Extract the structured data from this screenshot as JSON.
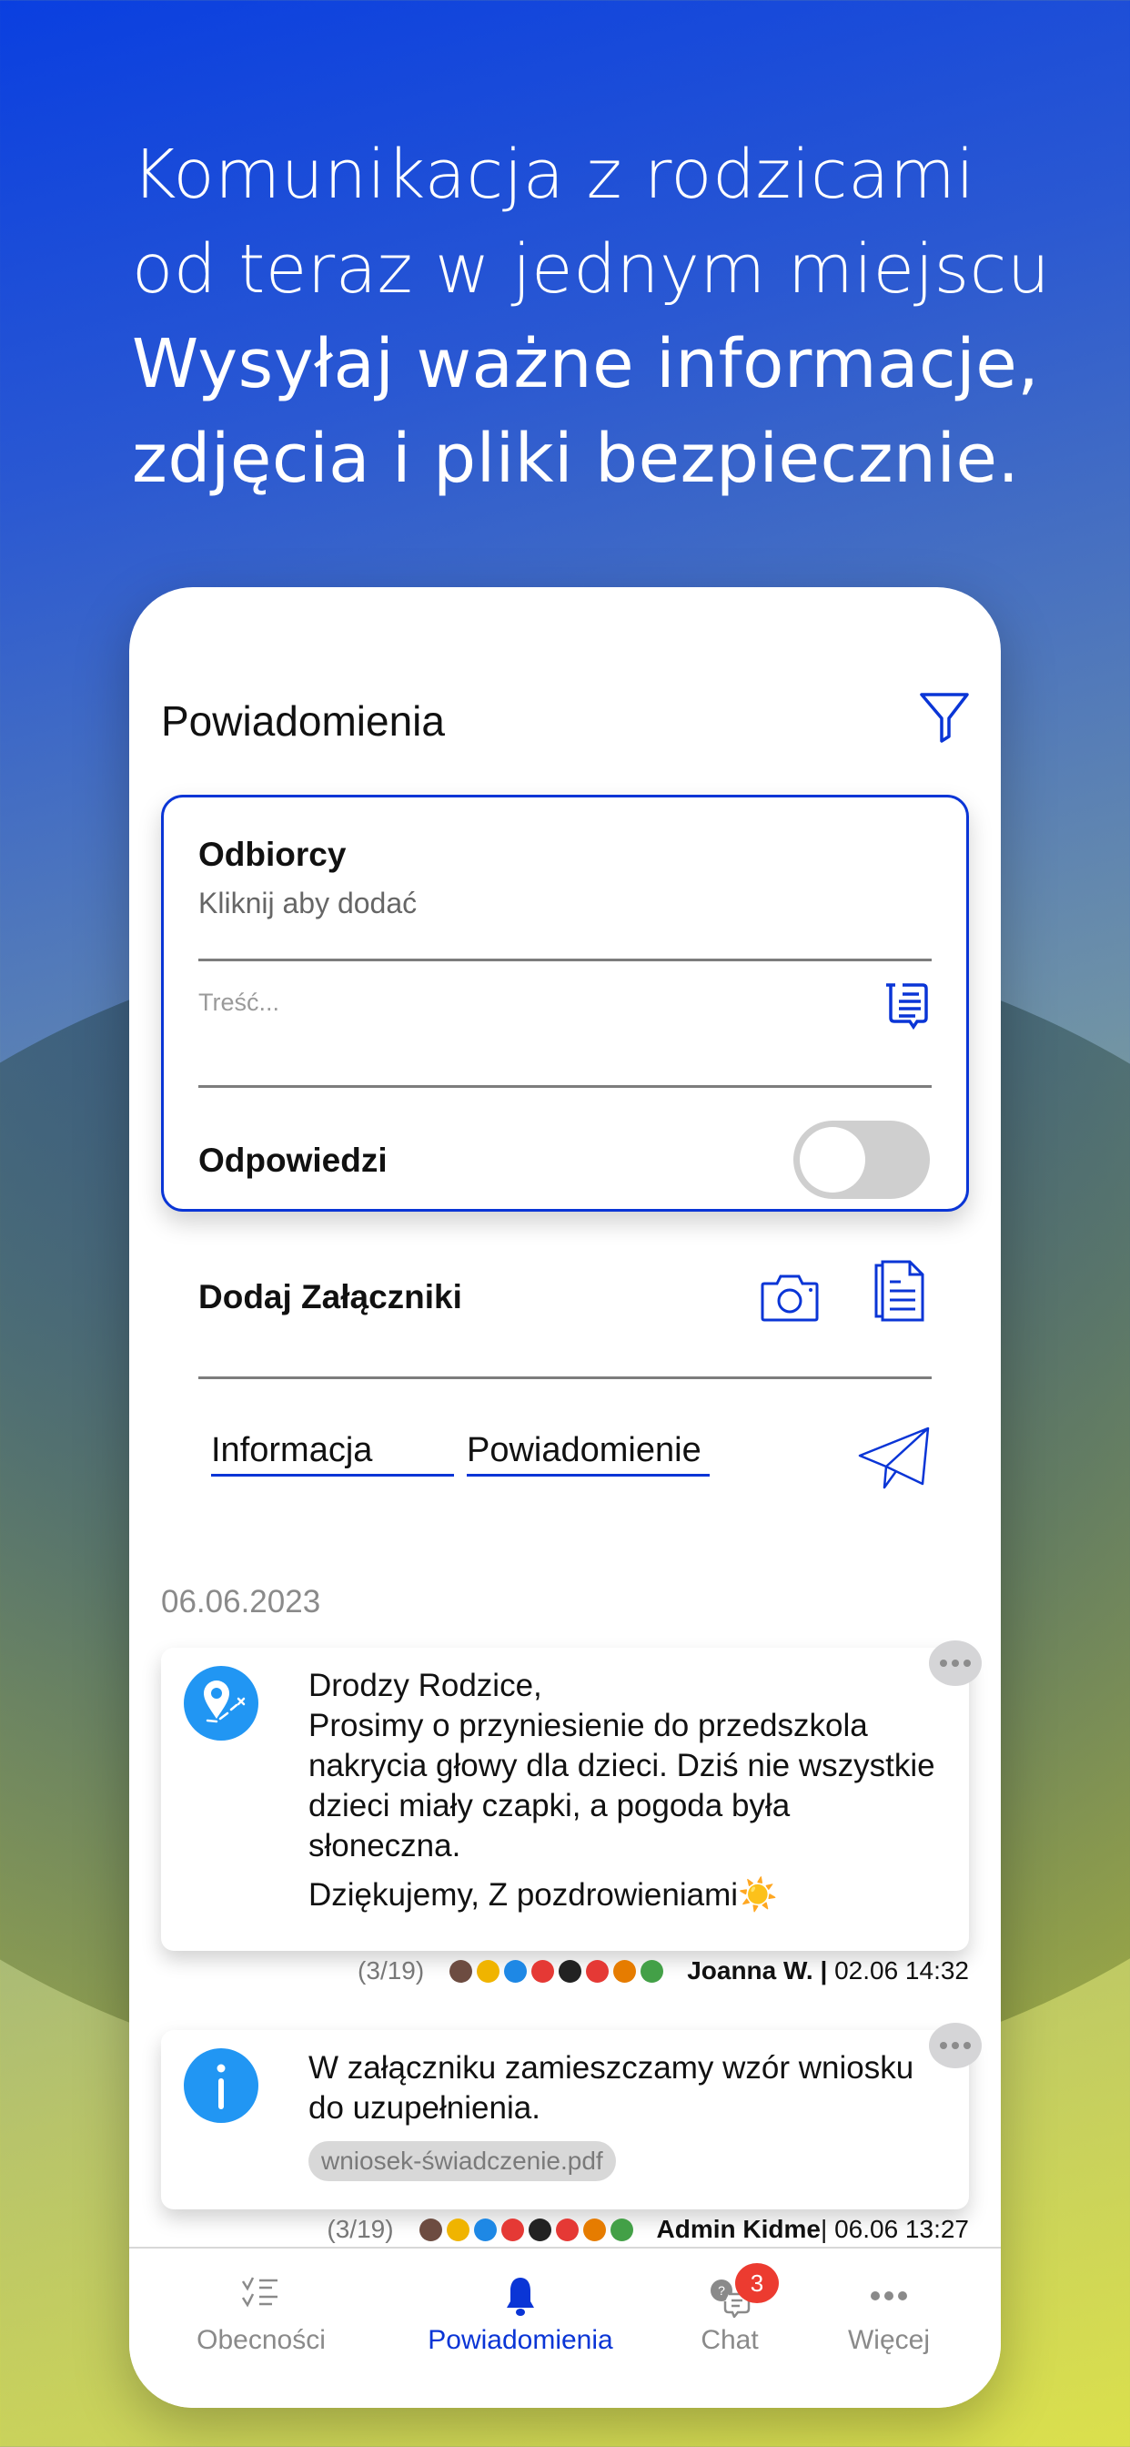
{
  "headline": {
    "line1": "Komunikacja z rodzicami",
    "line2": "od teraz w jednym miejscu",
    "line3": "Wysyłaj ważne informacje,",
    "line4": "zdjęcia i pliki bezpiecznie."
  },
  "header": {
    "title": "Powiadomienia",
    "filter_icon": "filter-icon"
  },
  "composer": {
    "recipients_label": "Odbiorcy",
    "recipients_hint": "Kliknij aby dodać",
    "content_placeholder": "Treść...",
    "replies_label": "Odpowiedzi",
    "replies_enabled": false,
    "attachments_label": "Dodaj Załączniki",
    "types": [
      {
        "label": "Informacja"
      },
      {
        "label": "Powiadomienie"
      }
    ],
    "icons": [
      "template-icon",
      "camera-icon",
      "document-icon",
      "send-icon"
    ]
  },
  "feed": {
    "date": "06.06.2023",
    "posts": [
      {
        "icon": "location-route-icon",
        "lines": [
          "Drodzy Rodzice,",
          "Prosimy o przyniesienie do przedszkola nakrycia głowy dla dzieci. Dziś nie wszystkie dzieci miały czapki, a pogoda była słoneczna.",
          "Dziękujemy, Z pozdrowieniami"
        ],
        "emoji": "☀️",
        "read_count": "(3/19)",
        "author": "Joanna W.",
        "separator": " | ",
        "time": "02.06 14:32"
      },
      {
        "icon": "info-icon",
        "lines": [
          "W załączniku zamieszczamy wzór wniosku do uzupełnienia."
        ],
        "attachment": "wniosek-świadczenie.pdf",
        "read_count": "(3/19)",
        "author": "Admin Kidme",
        "separator": "| ",
        "time": "06.06 13:27"
      }
    ],
    "group_colors": [
      "#6d4c41",
      "#f0b400",
      "#1e88e5",
      "#e53935",
      "#222222",
      "#e53935",
      "#e67c00",
      "#43a047"
    ]
  },
  "tabbar": {
    "items": [
      {
        "label": "Obecności",
        "icon": "checklist-icon",
        "active": false
      },
      {
        "label": "Powiadomienia",
        "icon": "bell-icon",
        "active": true
      },
      {
        "label": "Chat",
        "icon": "chat-icon",
        "active": false,
        "badge": "3"
      },
      {
        "label": "Więcej",
        "icon": "more-icon",
        "active": false
      }
    ]
  },
  "colors": {
    "accent": "#0a35d6",
    "icon_blue": "#2196f3",
    "badge_red": "#ec3b30"
  }
}
